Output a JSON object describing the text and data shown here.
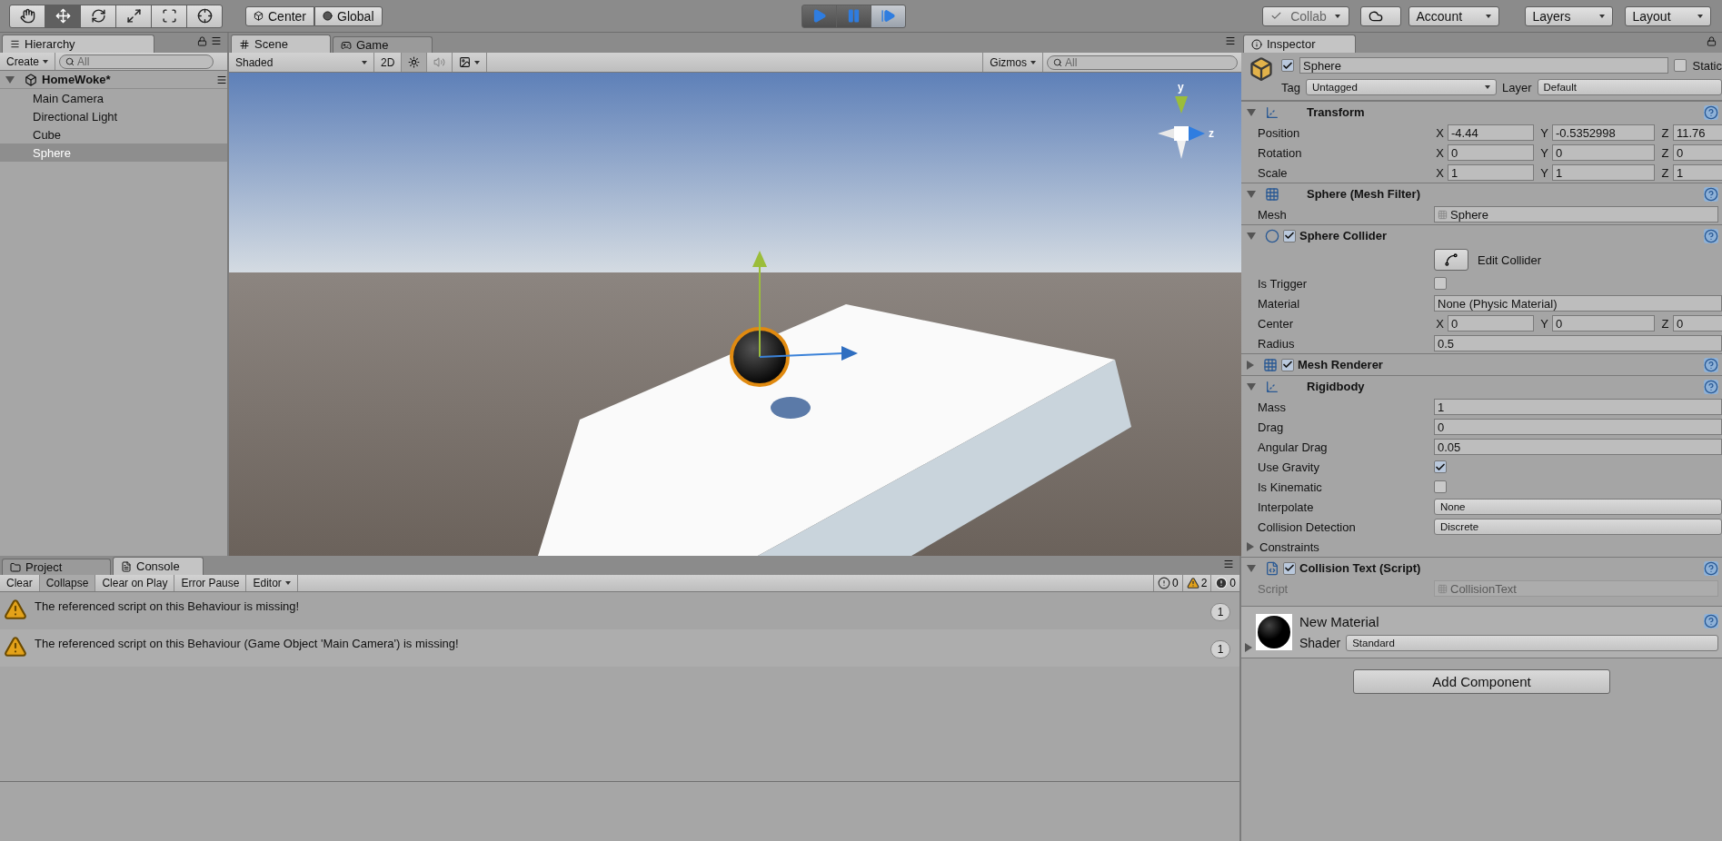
{
  "toolbar": {
    "tools": [
      {
        "kind": "hand",
        "selected": false
      },
      {
        "kind": "move",
        "selected": true
      },
      {
        "kind": "rotate",
        "selected": false
      },
      {
        "kind": "scale",
        "selected": false
      },
      {
        "kind": "rect",
        "selected": false
      },
      {
        "kind": "transform",
        "selected": false
      }
    ],
    "pivot": [
      "Center",
      "Global"
    ],
    "playback": [
      {
        "kind": "play",
        "selected": false
      },
      {
        "kind": "pause",
        "selected": false
      },
      {
        "kind": "step",
        "selected": true
      }
    ],
    "collab": "Collab",
    "account": "Account",
    "layers": "Layers",
    "layout": "Layout"
  },
  "hierarchy": {
    "tab": "Hierarchy",
    "create": "Create",
    "search_placeholder": "All",
    "scene": "HomeWoke*",
    "items": [
      {
        "label": "Main Camera",
        "selected": false
      },
      {
        "label": "Directional Light",
        "selected": false
      },
      {
        "label": "Cube",
        "selected": false
      },
      {
        "label": "Sphere",
        "selected": true
      }
    ]
  },
  "scene": {
    "tabs": [
      {
        "kind": "scene",
        "label": "Scene",
        "selected": true
      },
      {
        "kind": "game",
        "label": "Game",
        "selected": false
      }
    ],
    "shading": "Shaded",
    "mode_2d": "2D",
    "lighting_on": true,
    "audio_on": false,
    "gizmos": "Gizmos",
    "search_placeholder": "All",
    "axis_labels": [
      "y",
      "z"
    ]
  },
  "console": {
    "tabs": [
      {
        "kind": "project",
        "label": "Project",
        "selected": false
      },
      {
        "kind": "console",
        "label": "Console",
        "selected": true
      }
    ],
    "buttons": [
      {
        "label": "Clear",
        "on": false
      },
      {
        "label": "Collapse",
        "on": true
      },
      {
        "label": "Clear on Play",
        "on": false
      },
      {
        "label": "Error Pause",
        "on": false
      }
    ],
    "editor": "Editor",
    "counts": [
      {
        "kind": "info",
        "count": "0"
      },
      {
        "kind": "warning",
        "count": "2"
      },
      {
        "kind": "error",
        "count": "0"
      }
    ],
    "messages": [
      {
        "text": "The referenced script on this Behaviour is missing!",
        "count": "1"
      },
      {
        "text": "The referenced script on this Behaviour (Game Object 'Main Camera') is missing!",
        "count": "1"
      }
    ]
  },
  "inspector": {
    "tab": "Inspector",
    "object": {
      "name": "Sphere",
      "active": true,
      "static": false,
      "static_label": "Static",
      "tag_label": "Tag",
      "tag": "Untagged",
      "layer_label": "Layer",
      "layer": "Default"
    },
    "components": [
      {
        "kind": "transform",
        "title": "Transform",
        "expanded": true,
        "rows": [
          {
            "kind": "vector",
            "label": "Position",
            "values": [
              {
                "axis": "X",
                "value": "-4.44"
              },
              {
                "axis": "Y",
                "value": "-0.5352998"
              },
              {
                "axis": "Z",
                "value": "11.76"
              }
            ]
          },
          {
            "kind": "vector",
            "label": "Rotation",
            "values": [
              {
                "axis": "X",
                "value": "0"
              },
              {
                "axis": "Y",
                "value": "0"
              },
              {
                "axis": "Z",
                "value": "0"
              }
            ]
          },
          {
            "kind": "vector",
            "label": "Scale",
            "values": [
              {
                "axis": "X",
                "value": "1"
              },
              {
                "axis": "Y",
                "value": "1"
              },
              {
                "axis": "Z",
                "value": "1"
              }
            ]
          }
        ]
      },
      {
        "kind": "mesh_filter",
        "title": "Sphere (Mesh Filter)",
        "expanded": true,
        "rows": [
          {
            "kind": "object",
            "label": "Mesh",
            "value": "Sphere",
            "disabled": false
          }
        ]
      },
      {
        "kind": "collider",
        "title": "Sphere Collider",
        "enabled": true,
        "expanded": true,
        "rows": [
          {
            "kind": "button",
            "label": "Edit Collider"
          },
          {
            "kind": "check",
            "label": "Is Trigger",
            "checked": false
          },
          {
            "kind": "field",
            "label": "Material",
            "value": "None (Physic Material)"
          },
          {
            "kind": "vector",
            "label": "Center",
            "values": [
              {
                "axis": "X",
                "value": "0"
              },
              {
                "axis": "Y",
                "value": "0"
              },
              {
                "axis": "Z",
                "value": "0"
              }
            ]
          },
          {
            "kind": "field",
            "label": "Radius",
            "value": "0.5"
          }
        ]
      },
      {
        "kind": "renderer",
        "title": "Mesh Renderer",
        "enabled": true,
        "expanded": false
      },
      {
        "kind": "rigidbody",
        "title": "Rigidbody",
        "expanded": true,
        "rows": [
          {
            "kind": "field",
            "label": "Mass",
            "value": "1"
          },
          {
            "kind": "field",
            "label": "Drag",
            "value": "0"
          },
          {
            "kind": "field",
            "label": "Angular Drag",
            "value": "0.05"
          },
          {
            "kind": "check",
            "label": "Use Gravity",
            "checked": true
          },
          {
            "kind": "check",
            "label": "Is Kinematic",
            "checked": false
          },
          {
            "kind": "dropdown",
            "label": "Interpolate",
            "value": "None"
          },
          {
            "kind": "dropdown",
            "label": "Collision Detection",
            "value": "Discrete"
          },
          {
            "kind": "foldout",
            "label": "Constraints",
            "expanded": false
          }
        ]
      },
      {
        "kind": "script",
        "title": "Collision Text (Script)",
        "enabled": true,
        "expanded": true,
        "rows": [
          {
            "kind": "object",
            "label": "Script",
            "value": "CollisionText",
            "disabled": true
          }
        ]
      }
    ],
    "material": {
      "name": "New Material",
      "shader_label": "Shader",
      "shader": "Standard",
      "expanded": false
    },
    "add_component": "Add Component"
  }
}
